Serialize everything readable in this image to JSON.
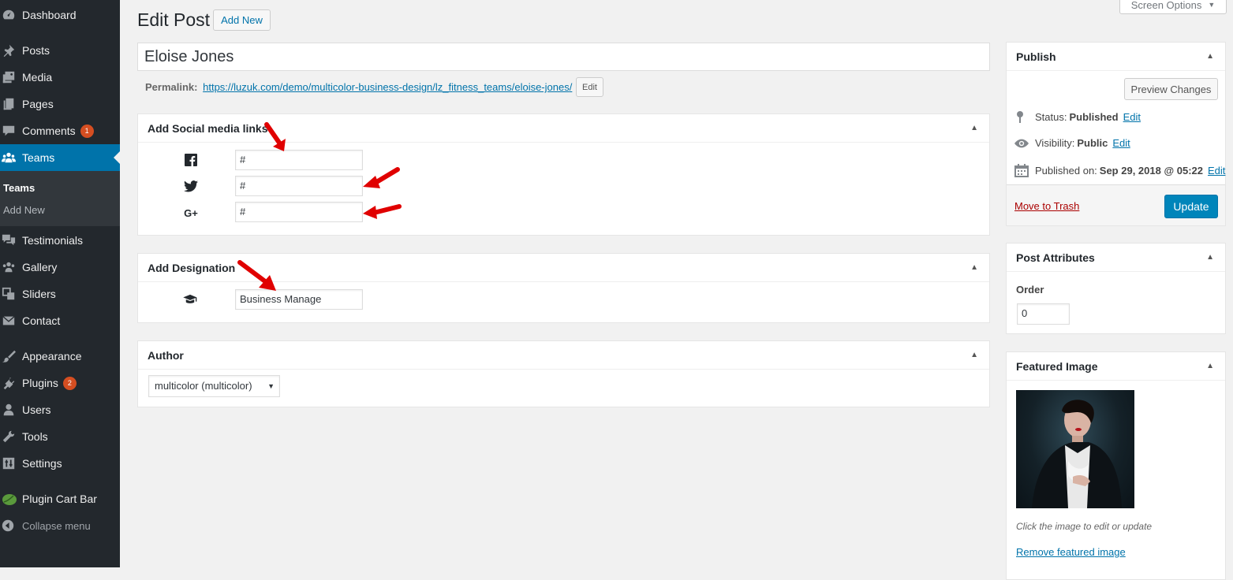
{
  "sidebar": {
    "items": [
      {
        "label": "Dashboard",
        "icon": "dashboard-icon"
      },
      {
        "label": "Posts",
        "icon": "pin-icon"
      },
      {
        "label": "Media",
        "icon": "media-icon"
      },
      {
        "label": "Pages",
        "icon": "pages-icon"
      },
      {
        "label": "Comments",
        "icon": "comment-icon",
        "badge": "1"
      },
      {
        "label": "Teams",
        "icon": "groups-icon",
        "active": true
      },
      {
        "label": "Testimonials",
        "icon": "testimonial-icon"
      },
      {
        "label": "Gallery",
        "icon": "gallery-icon"
      },
      {
        "label": "Sliders",
        "icon": "slides-icon"
      },
      {
        "label": "Contact",
        "icon": "email-icon"
      },
      {
        "label": "Appearance",
        "icon": "brush-icon"
      },
      {
        "label": "Plugins",
        "icon": "plugin-icon",
        "badge": "2"
      },
      {
        "label": "Users",
        "icon": "users-icon"
      },
      {
        "label": "Tools",
        "icon": "wrench-icon"
      },
      {
        "label": "Settings",
        "icon": "settings-icon"
      },
      {
        "label": "Plugin Cart Bar",
        "icon": "leaf-icon"
      },
      {
        "label": "Collapse menu",
        "icon": "collapse-icon"
      }
    ],
    "submenu": {
      "current": "Teams",
      "add_new": "Add New"
    }
  },
  "header": {
    "title": "Edit Post",
    "add_new": "Add New",
    "screen_options": "Screen Options"
  },
  "post": {
    "title": "Eloise Jones",
    "permalink_label": "Permalink:",
    "permalink_base": "https://luzuk.com/demo/multicolor-business-design/lz_fitness_teams/",
    "permalink_slug": "eloise-jones",
    "permalink_end": "/",
    "permalink_edit": "Edit"
  },
  "social": {
    "title": "Add Social media links",
    "facebook": "#",
    "twitter": "#",
    "googleplus": "#",
    "googleplus_glyph": "G+"
  },
  "designation": {
    "title": "Add Designation",
    "value": "Business Manage"
  },
  "author": {
    "title": "Author",
    "selected": "multicolor (multicolor)"
  },
  "publish": {
    "title": "Publish",
    "preview": "Preview Changes",
    "status_label": "Status:",
    "status_value": "Published",
    "visibility_label": "Visibility:",
    "visibility_value": "Public",
    "published_label": "Published on:",
    "published_value": "Sep 29, 2018 @ 05:22",
    "edit": "Edit",
    "trash": "Move to Trash",
    "update": "Update"
  },
  "attributes": {
    "title": "Post Attributes",
    "order_label": "Order",
    "order_value": "0"
  },
  "featured": {
    "title": "Featured Image",
    "hint": "Click the image to edit or update",
    "remove": "Remove featured image"
  },
  "colors": {
    "sidebar": "#23282d",
    "active": "#0073aa",
    "badge": "#d54e21",
    "primary_button": "#0085ba",
    "annotation_arrow": "#e00000"
  }
}
